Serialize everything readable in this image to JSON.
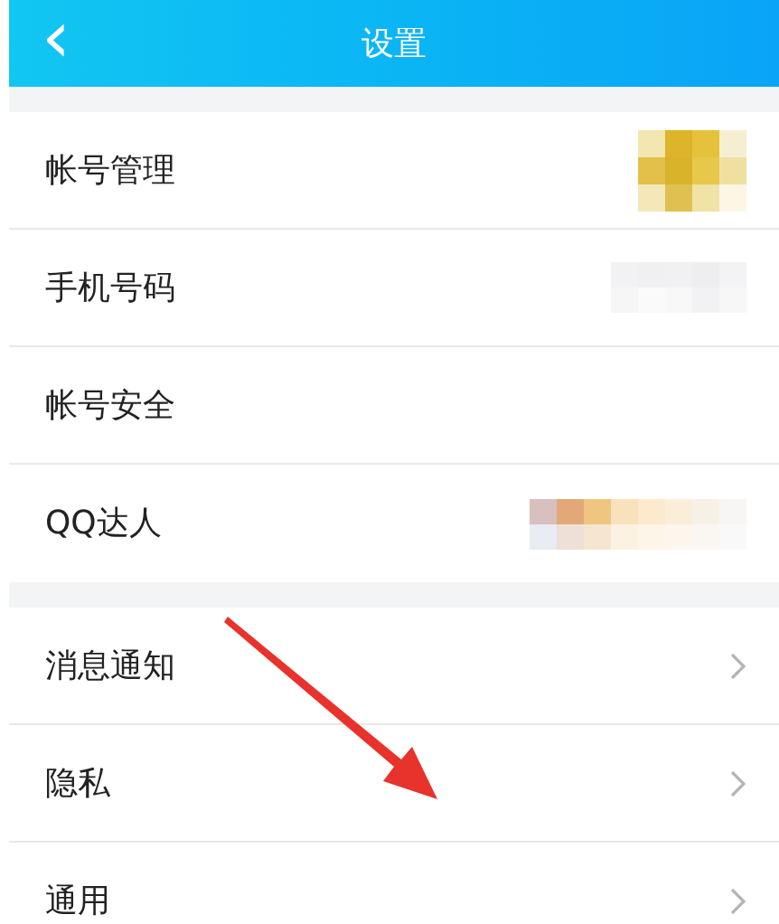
{
  "header": {
    "back_icon": "‹",
    "title": "设置"
  },
  "groups": [
    {
      "rows": [
        {
          "label": "帐号管理",
          "kind": "avatar"
        },
        {
          "label": "手机号码",
          "kind": "faint"
        },
        {
          "label": "帐号安全",
          "kind": "plain"
        },
        {
          "label": "QQ达人",
          "kind": "strip"
        }
      ]
    },
    {
      "rows": [
        {
          "label": "消息通知",
          "kind": "link"
        },
        {
          "label": "隐私",
          "kind": "link"
        },
        {
          "label": "通用",
          "kind": "link"
        }
      ]
    }
  ]
}
